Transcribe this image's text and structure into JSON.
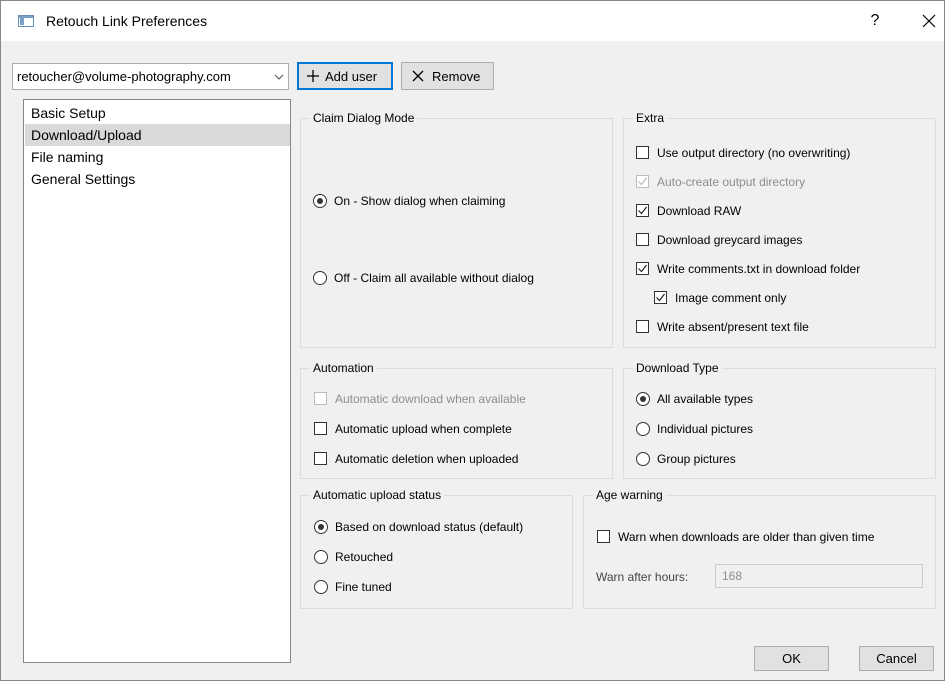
{
  "window": {
    "title": "Retouch Link Preferences",
    "help_glyph": "?"
  },
  "account": {
    "selected_user": "retoucher@volume-photography.com",
    "add_user_label": "Add user",
    "remove_label": "Remove"
  },
  "nav": {
    "items": [
      {
        "label": "Basic Setup",
        "selected": false
      },
      {
        "label": "Download/Upload",
        "selected": true
      },
      {
        "label": "File naming",
        "selected": false
      },
      {
        "label": "General Settings",
        "selected": false
      }
    ]
  },
  "claim_dialog_mode": {
    "title": "Claim Dialog Mode",
    "options": [
      {
        "label": "On - Show dialog when claiming",
        "checked": true
      },
      {
        "label": "Off - Claim all available without dialog",
        "checked": false
      }
    ]
  },
  "extra": {
    "title": "Extra",
    "options": [
      {
        "label": "Use output directory (no overwriting)",
        "checked": false,
        "disabled": false
      },
      {
        "label": "Auto-create output directory",
        "checked": true,
        "disabled": true
      },
      {
        "label": "Download RAW",
        "checked": true,
        "disabled": false
      },
      {
        "label": "Download greycard images",
        "checked": false,
        "disabled": false
      },
      {
        "label": "Write comments.txt in download folder",
        "checked": true,
        "disabled": false
      },
      {
        "label": "Image comment only",
        "checked": true,
        "disabled": false
      },
      {
        "label": "Write absent/present text file",
        "checked": false,
        "disabled": false
      }
    ]
  },
  "automation": {
    "title": "Automation",
    "options": [
      {
        "label": "Automatic download when available",
        "checked": false,
        "disabled": true
      },
      {
        "label": "Automatic upload when complete",
        "checked": false,
        "disabled": false
      },
      {
        "label": "Automatic deletion when uploaded",
        "checked": false,
        "disabled": false
      }
    ]
  },
  "download_type": {
    "title": "Download Type",
    "options": [
      {
        "label": "All available types",
        "checked": true
      },
      {
        "label": "Individual pictures",
        "checked": false
      },
      {
        "label": "Group pictures",
        "checked": false
      }
    ]
  },
  "upload_status": {
    "title": "Automatic upload status",
    "options": [
      {
        "label": "Based on download status (default)",
        "checked": true
      },
      {
        "label": "Retouched",
        "checked": false
      },
      {
        "label": "Fine tuned",
        "checked": false
      }
    ]
  },
  "age_warning": {
    "title": "Age warning",
    "warn_label": "Warn when downloads are older than given time",
    "warn_checked": false,
    "hours_label": "Warn after hours:",
    "hours_value": "168"
  },
  "footer": {
    "ok_label": "OK",
    "cancel_label": "Cancel"
  },
  "colors": {
    "window_bg": "#f0f0f0",
    "accent_focus": "#0078d7",
    "nav_selected": "#d9d9d9"
  }
}
